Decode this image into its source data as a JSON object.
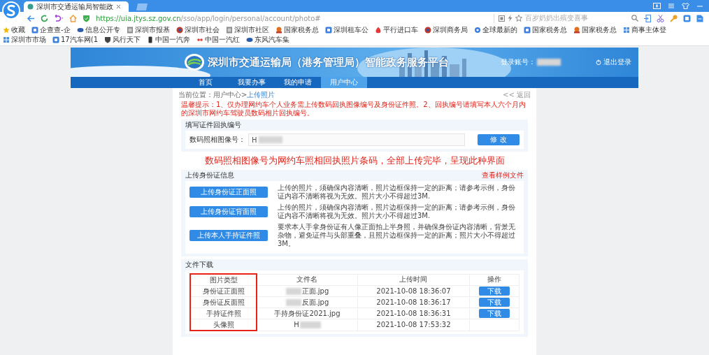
{
  "browser": {
    "tab_title": "深圳市交通运输局智能政",
    "url_host": "https://uia.jtys.sz.gov.cn",
    "url_path": "/sso/app/login/personal/account/photo#",
    "search_placeholder": "百岁奶奶出殡变喜事",
    "bookmarks": [
      {
        "label": "收藏",
        "kind": "star"
      },
      {
        "label": "企查查-企",
        "kind": "square"
      },
      {
        "label": "信息公开专",
        "kind": "disc"
      },
      {
        "label": "深圳市报基",
        "kind": "page"
      },
      {
        "label": "深圳市社会",
        "kind": "badge"
      },
      {
        "label": "深圳市社区",
        "kind": "page"
      },
      {
        "label": "国家税务总",
        "kind": "emblem"
      },
      {
        "label": "深圳租车公",
        "kind": "square"
      },
      {
        "label": "平行进口车",
        "kind": "flame"
      },
      {
        "label": "深圳商务局",
        "kind": "badge"
      },
      {
        "label": "全球最新的",
        "kind": "gear"
      },
      {
        "label": "国家税务总",
        "kind": "square"
      },
      {
        "label": "国家税务总",
        "kind": "emblem"
      },
      {
        "label": "商事主体登",
        "kind": "grid"
      },
      {
        "label": "深圳市市场",
        "kind": "grid"
      },
      {
        "label": "17汽车网(1",
        "kind": "square"
      },
      {
        "label": "风行天下",
        "kind": "shield"
      },
      {
        "label": "中国一汽奔",
        "kind": "phone"
      },
      {
        "label": "中国一汽红",
        "kind": "dots"
      },
      {
        "label": "东风汽车集",
        "kind": "disc"
      }
    ]
  },
  "header": {
    "title": "深圳市交通运输局（港务管理局）智能政务服务平台",
    "account_label": "登录账号：",
    "logout": "退出登录"
  },
  "nav": [
    {
      "label": "首页",
      "selected": false
    },
    {
      "label": "我要办事",
      "selected": false
    },
    {
      "label": "我的申请",
      "selected": false
    },
    {
      "label": "用户中心",
      "selected": true
    }
  ],
  "breadcrumb": {
    "prefix": "当前位置：用户中心>",
    "current": "上传照片",
    "back": "<< 返回"
  },
  "notice": "温馨提示：1、仅办理网约车个人业务需上传数码回执图像编号及身份证件照。2、回执编号请填写本人六个月内的深圳市网约车驾驶员数码相片回执编号。",
  "receipt": {
    "title": "填写证件回执编号",
    "label": "数码照相图像号：",
    "value": "H",
    "button": "修 改"
  },
  "annotation": "数码照相图像号为网约车照相回执照片条码，全部上传完毕，呈现此种界面",
  "upload": {
    "title": "上传身份证信息",
    "sample_link": "查看样例文件",
    "items": [
      {
        "button": "上传身份证正面照",
        "description": "上传的照片，须确保内容清晰，照片边框保持一定的距离；请参考示例，身份证内容不清晰将视为无效。照片大小不得超过3M."
      },
      {
        "button": "上传身份证背面照",
        "description": "上传的照片，须确保内容清晰，照片边框保持一定的距离；请参考示例，身份证内容不清晰将视为无效。照片大小不得超过3M."
      },
      {
        "button": "上传本人手持证件照",
        "description": "要求本人手拿身份证有人像正面拍上半身照，并确保身份证内容清晰，背景无杂物，避免证件与头部重叠，且照片边框保持一定的距离；照片大小不得超过3M。"
      }
    ]
  },
  "downloads": {
    "title": "文件下载",
    "columns": [
      "图片类型",
      "文件名",
      "上传时间",
      "操作"
    ],
    "rows": [
      {
        "type": "身份证正面照",
        "file": "正面.jpg",
        "kind": "prefix",
        "time": "2021-10-08 18:36:07",
        "action": "下载"
      },
      {
        "type": "身份证反面照",
        "file": "反面.jpg",
        "kind": "prefix",
        "time": "2021-10-08 18:36:17",
        "action": "下载"
      },
      {
        "type": "手持证件照",
        "file": "手持身份证2021.jpg",
        "kind": "plain",
        "time": "2021-10-08 18:36:31",
        "action": "下载"
      },
      {
        "type": "头像照",
        "file": "H",
        "kind": "suffix",
        "time": "2021-10-08 17:53:32"
      }
    ]
  }
}
